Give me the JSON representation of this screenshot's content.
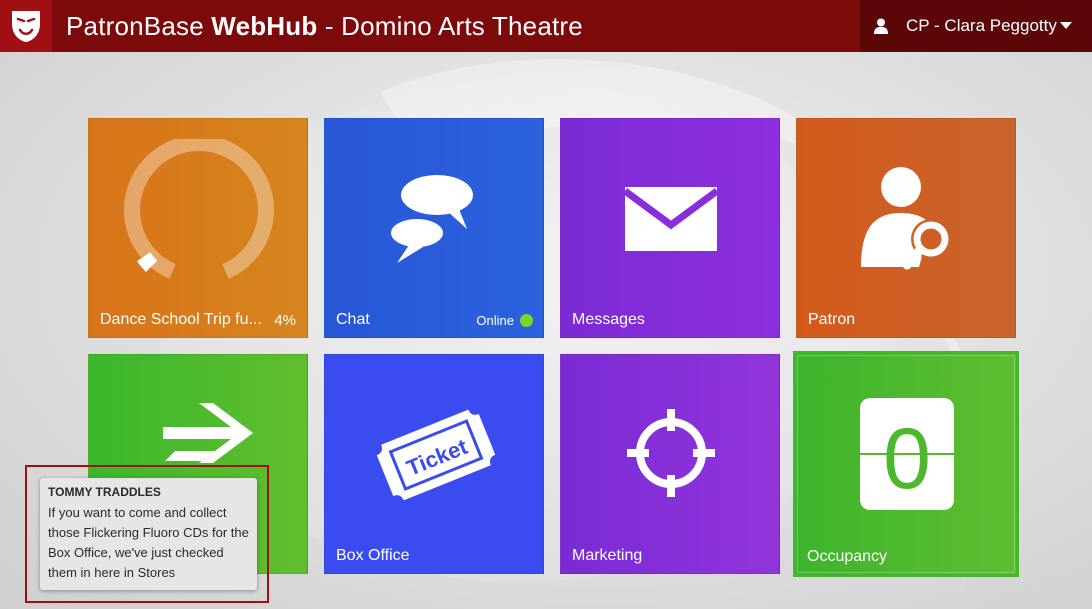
{
  "header": {
    "app_prefix": "PatronBase ",
    "app_bold": "WebHub",
    "app_suffix": " - Domino Arts Theatre",
    "logo_icon": "theatre-mask-icon",
    "user_icon": "user-icon",
    "user_name": "CP - Clara Peggotty",
    "user_menu_icon": "caret-down-icon",
    "bar_color": "#7c0a0a"
  },
  "tiles": [
    {
      "id": "dance",
      "label": "Dance School Trip fu...",
      "value": "4%",
      "progress": 0.04,
      "icon": "gauge-ring-icon",
      "color": "#d8731a"
    },
    {
      "id": "chat",
      "label": "Chat",
      "status": "Online",
      "status_color": "#7bd62b",
      "icon": "speech-bubbles-icon",
      "color": "#2756d6"
    },
    {
      "id": "messages",
      "label": "Messages",
      "icon": "envelope-icon",
      "color": "#7a2bd4"
    },
    {
      "id": "patron",
      "label": "Patron",
      "icon": "person-search-icon",
      "color": "#d45a1c"
    },
    {
      "id": "transfer",
      "label": "",
      "icon": "arrow-right-icon",
      "color": "#39b82c"
    },
    {
      "id": "boxoffice",
      "label": "Box Office",
      "icon": "ticket-icon",
      "ticket_text": "Ticket",
      "color": "#3a4cf0"
    },
    {
      "id": "marketing",
      "label": "Marketing",
      "icon": "crosshair-icon",
      "color": "#7a2bd4"
    },
    {
      "id": "occupancy",
      "label": "Occupancy",
      "value": "0",
      "icon": "flip-counter-icon",
      "color": "#3db52c"
    }
  ],
  "notification": {
    "sender": "TOMMY TRADDLES",
    "message": "If you want to come and collect those Flickering Fluoro CDs for the Box Office, we've just checked them in here in Stores"
  }
}
